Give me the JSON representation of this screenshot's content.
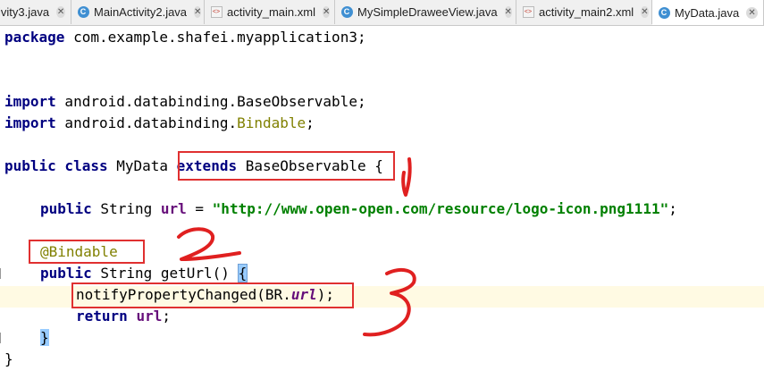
{
  "tabs": [
    {
      "label": "ivity3.java",
      "icon": "java-class-icon",
      "type": "java",
      "active": false
    },
    {
      "label": "MainActivity2.java",
      "icon": "java-class-icon",
      "type": "java",
      "active": false
    },
    {
      "label": "activity_main.xml",
      "icon": "xml-layout-icon",
      "type": "xml",
      "active": false
    },
    {
      "label": "MySimpleDraweeView.java",
      "icon": "java-class-icon",
      "type": "java",
      "active": false
    },
    {
      "label": "activity_main2.xml",
      "icon": "xml-layout-icon",
      "type": "xml",
      "active": false
    },
    {
      "label": "MyData.java",
      "icon": "java-class-icon",
      "type": "java",
      "active": true
    }
  ],
  "code": {
    "l1_kw": "package",
    "l1_rest": " com.example.shafei.myapplication3;",
    "l2_kw": "import",
    "l2_rest": " android.databinding.BaseObservable;",
    "l3_kw": "import",
    "l3_rest": " android.databinding.",
    "l3_ann": "Bindable",
    "l3_end": ";",
    "l4_kw": "public class",
    "l4_name": " MyData ",
    "l4_ext": "extends",
    "l4_base": " BaseObservable",
    "l4_brace": "{",
    "l5_kw": "public",
    "l5_type": " String ",
    "l5_field": "url",
    "l5_eq": " = ",
    "l5_str": "\"http://www.open-open.com/resource/logo-icon.png1111\"",
    "l5_end": ";",
    "l6_ann": "@Bindable",
    "l7_kw": "public",
    "l7_rest": " String getUrl() ",
    "l7_brace": "{",
    "l8_call": "notifyPropertyChanged(BR.",
    "l8_field": "url",
    "l8_end": ");",
    "l9_kw": "return",
    "l9_sp": " ",
    "l9_field": "url",
    "l9_end": ";",
    "l10_brace": "}",
    "l11_brace": "}"
  },
  "colors": {
    "keyword": "#000080",
    "string": "#008000",
    "annotation": "#808000",
    "field": "#660e7a",
    "annotation_box": "#e03030",
    "current_line": "#fffae3"
  }
}
